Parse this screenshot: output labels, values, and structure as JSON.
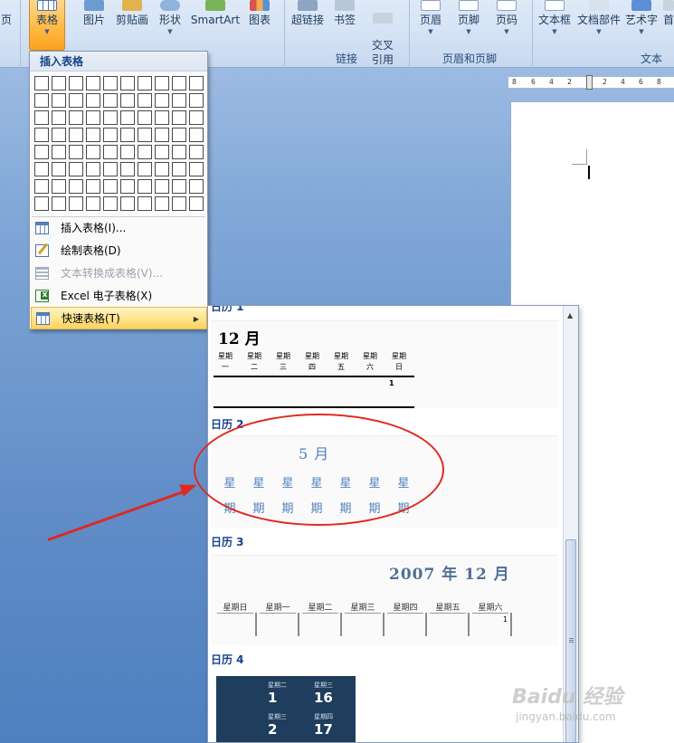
{
  "ribbon": {
    "buttons": [
      {
        "label": "页",
        "x": 0
      },
      {
        "label": "表格"
      },
      {
        "label": "图片"
      },
      {
        "label": "剪贴画"
      },
      {
        "label": "形状"
      },
      {
        "label": "SmartArt"
      },
      {
        "label": "图表"
      },
      {
        "label": "超链接"
      },
      {
        "label": "书签"
      },
      {
        "label": "交叉\n引用"
      },
      {
        "label": "页眉"
      },
      {
        "label": "页脚"
      },
      {
        "label": "页码"
      },
      {
        "label": "文本框"
      },
      {
        "label": "文档部件"
      },
      {
        "label": "艺术字"
      },
      {
        "label": "首"
      }
    ],
    "groups": {
      "links": "链接",
      "header_footer": "页眉和页脚",
      "text": "文本"
    }
  },
  "ruler": {
    "ticks": [
      "8",
      "6",
      "4",
      "2",
      "2",
      "4",
      "6",
      "8"
    ]
  },
  "menu": {
    "header": "插入表格",
    "grid_cols": 10,
    "grid_rows": 8,
    "items": [
      {
        "label": "插入表格(I)...",
        "enabled": true
      },
      {
        "label": "绘制表格(D)",
        "enabled": true
      },
      {
        "label": "文本转换成表格(V)...",
        "enabled": false
      },
      {
        "label": "Excel 电子表格(X)",
        "enabled": true
      },
      {
        "label": "快速表格(T)",
        "enabled": true,
        "highlighted": true
      }
    ]
  },
  "quick_tables": {
    "cal1": {
      "partial_title": "日历 1",
      "month": "12 月",
      "days": [
        [
          "星期",
          "一"
        ],
        [
          "星期",
          "二"
        ],
        [
          "星期",
          "三"
        ],
        [
          "星期",
          "四"
        ],
        [
          "星期",
          "五"
        ],
        [
          "星期",
          "六"
        ],
        [
          "星期",
          "日"
        ]
      ],
      "first_day": "1"
    },
    "cal2": {
      "title": "日历 2",
      "month": "5 月",
      "row1": [
        "星",
        "星",
        "星",
        "星",
        "星",
        "星",
        "星"
      ],
      "row2": [
        "期",
        "期",
        "期",
        "期",
        "期",
        "期",
        "期"
      ]
    },
    "cal3": {
      "title": "日历 3",
      "month": "2007 年 12 月",
      "days": [
        "星期日",
        "星期一",
        "星期二",
        "星期三",
        "星期四",
        "星期五",
        "星期六"
      ],
      "first_day": "1"
    },
    "cal4": {
      "title": "日历 4",
      "cells": [
        {
          "day": "星期二",
          "num": "1"
        },
        {
          "day": "星期三",
          "num": "16"
        },
        {
          "day": "星期三",
          "num": "2"
        },
        {
          "day": "星期四",
          "num": "17"
        }
      ]
    }
  },
  "colors": {
    "accent_red": "#e0281f",
    "highlight": "#ffd35f",
    "cal_blue": "#4f81bd"
  },
  "watermark": {
    "brand": "Baidu 经验",
    "url": "jingyan.baidu.com"
  }
}
